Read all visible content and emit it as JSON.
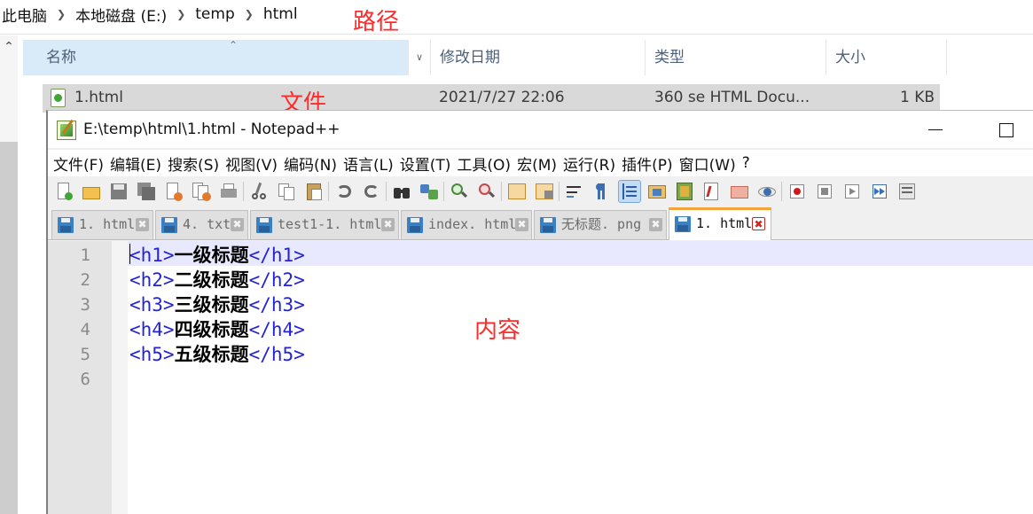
{
  "explorer": {
    "breadcrumb": [
      "此电脑",
      "本地磁盘 (E:)",
      "temp",
      "html"
    ],
    "columns": {
      "name": "名称",
      "date": "修改日期",
      "type": "类型",
      "size": "大小"
    },
    "file": {
      "name": "1.html",
      "date": "2021/7/27 22:06",
      "type": "360 se HTML Docu...",
      "size": "1 KB"
    }
  },
  "annotations": {
    "path": "路径",
    "file": "文件",
    "content": "内容"
  },
  "notepad": {
    "title": "E:\\temp\\html\\1.html - Notepad++",
    "menu": [
      "文件(F)",
      "编辑(E)",
      "搜索(S)",
      "视图(V)",
      "编码(N)",
      "语言(L)",
      "设置(T)",
      "工具(O)",
      "宏(M)",
      "运行(R)",
      "插件(P)",
      "窗口(W)",
      "?"
    ],
    "tabs": [
      {
        "label": "1. html"
      },
      {
        "label": "4. txt"
      },
      {
        "label": "test1-1. html"
      },
      {
        "label": "index. html"
      },
      {
        "label": "无标题. png"
      },
      {
        "label": "1. html"
      }
    ],
    "active_tab": 5,
    "lines": [
      {
        "no": "1",
        "open": "<h1>",
        "text": "一级标题",
        "close": "</h1>"
      },
      {
        "no": "2",
        "open": "<h2>",
        "text": "二级标题",
        "close": "</h2>"
      },
      {
        "no": "3",
        "open": "<h3>",
        "text": "三级标题",
        "close": "</h3>"
      },
      {
        "no": "4",
        "open": "<h4>",
        "text": "四级标题",
        "close": "</h4>"
      },
      {
        "no": "5",
        "open": "<h5>",
        "text": "五级标题",
        "close": "</h5>"
      },
      {
        "no": "6",
        "open": "",
        "text": "",
        "close": ""
      }
    ],
    "colors": {
      "tag": "#2323d6",
      "current_line": "#e8e8ff",
      "active_tab_accent": "#f2a33a",
      "annotation": "#ff2a2a"
    }
  }
}
